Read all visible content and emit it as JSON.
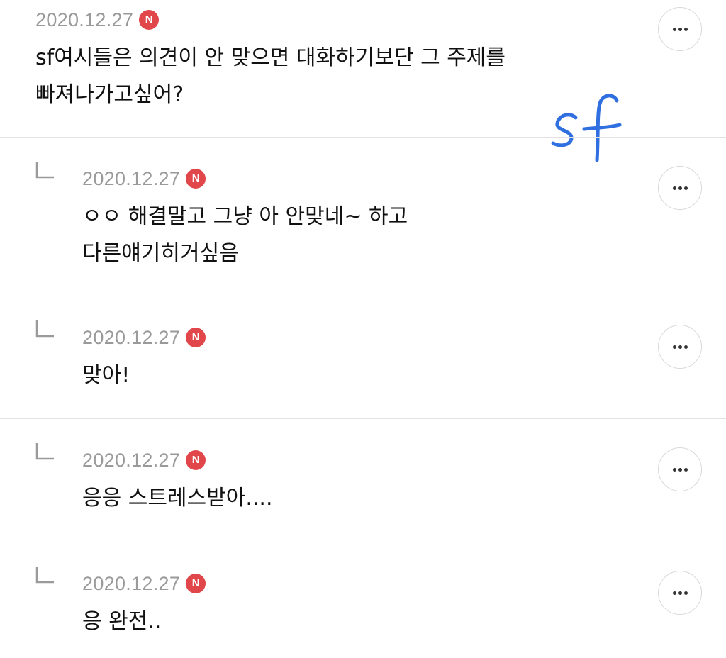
{
  "comments": [
    {
      "date": "2020.12.27",
      "badge": "N",
      "text": "sf여시들은 의견이 안 맞으면 대화하기보단 그 주제를\n빠져나가고싶어?",
      "reply": false
    },
    {
      "date": "2020.12.27",
      "badge": "N",
      "text": "ㅇㅇ 해결말고 그냥 아 안맞네~ 하고\n다른얘기히거싶음",
      "reply": true
    },
    {
      "date": "2020.12.27",
      "badge": "N",
      "text": "맞아!",
      "reply": true
    },
    {
      "date": "2020.12.27",
      "badge": "N",
      "text": "응응 스트레스받아....",
      "reply": true
    },
    {
      "date": "2020.12.27",
      "badge": "N",
      "text": "응 완전..",
      "reply": true
    }
  ],
  "annotation": {
    "text": "sf",
    "color": "#2f6fe0"
  },
  "icons": {
    "more": "more-horizontal-icon",
    "reply": "reply-arrow-icon",
    "new": "new-badge-icon"
  },
  "colors": {
    "badge": "#e0464a",
    "date": "#9a9a9a",
    "divider": "#e2e2e2"
  }
}
